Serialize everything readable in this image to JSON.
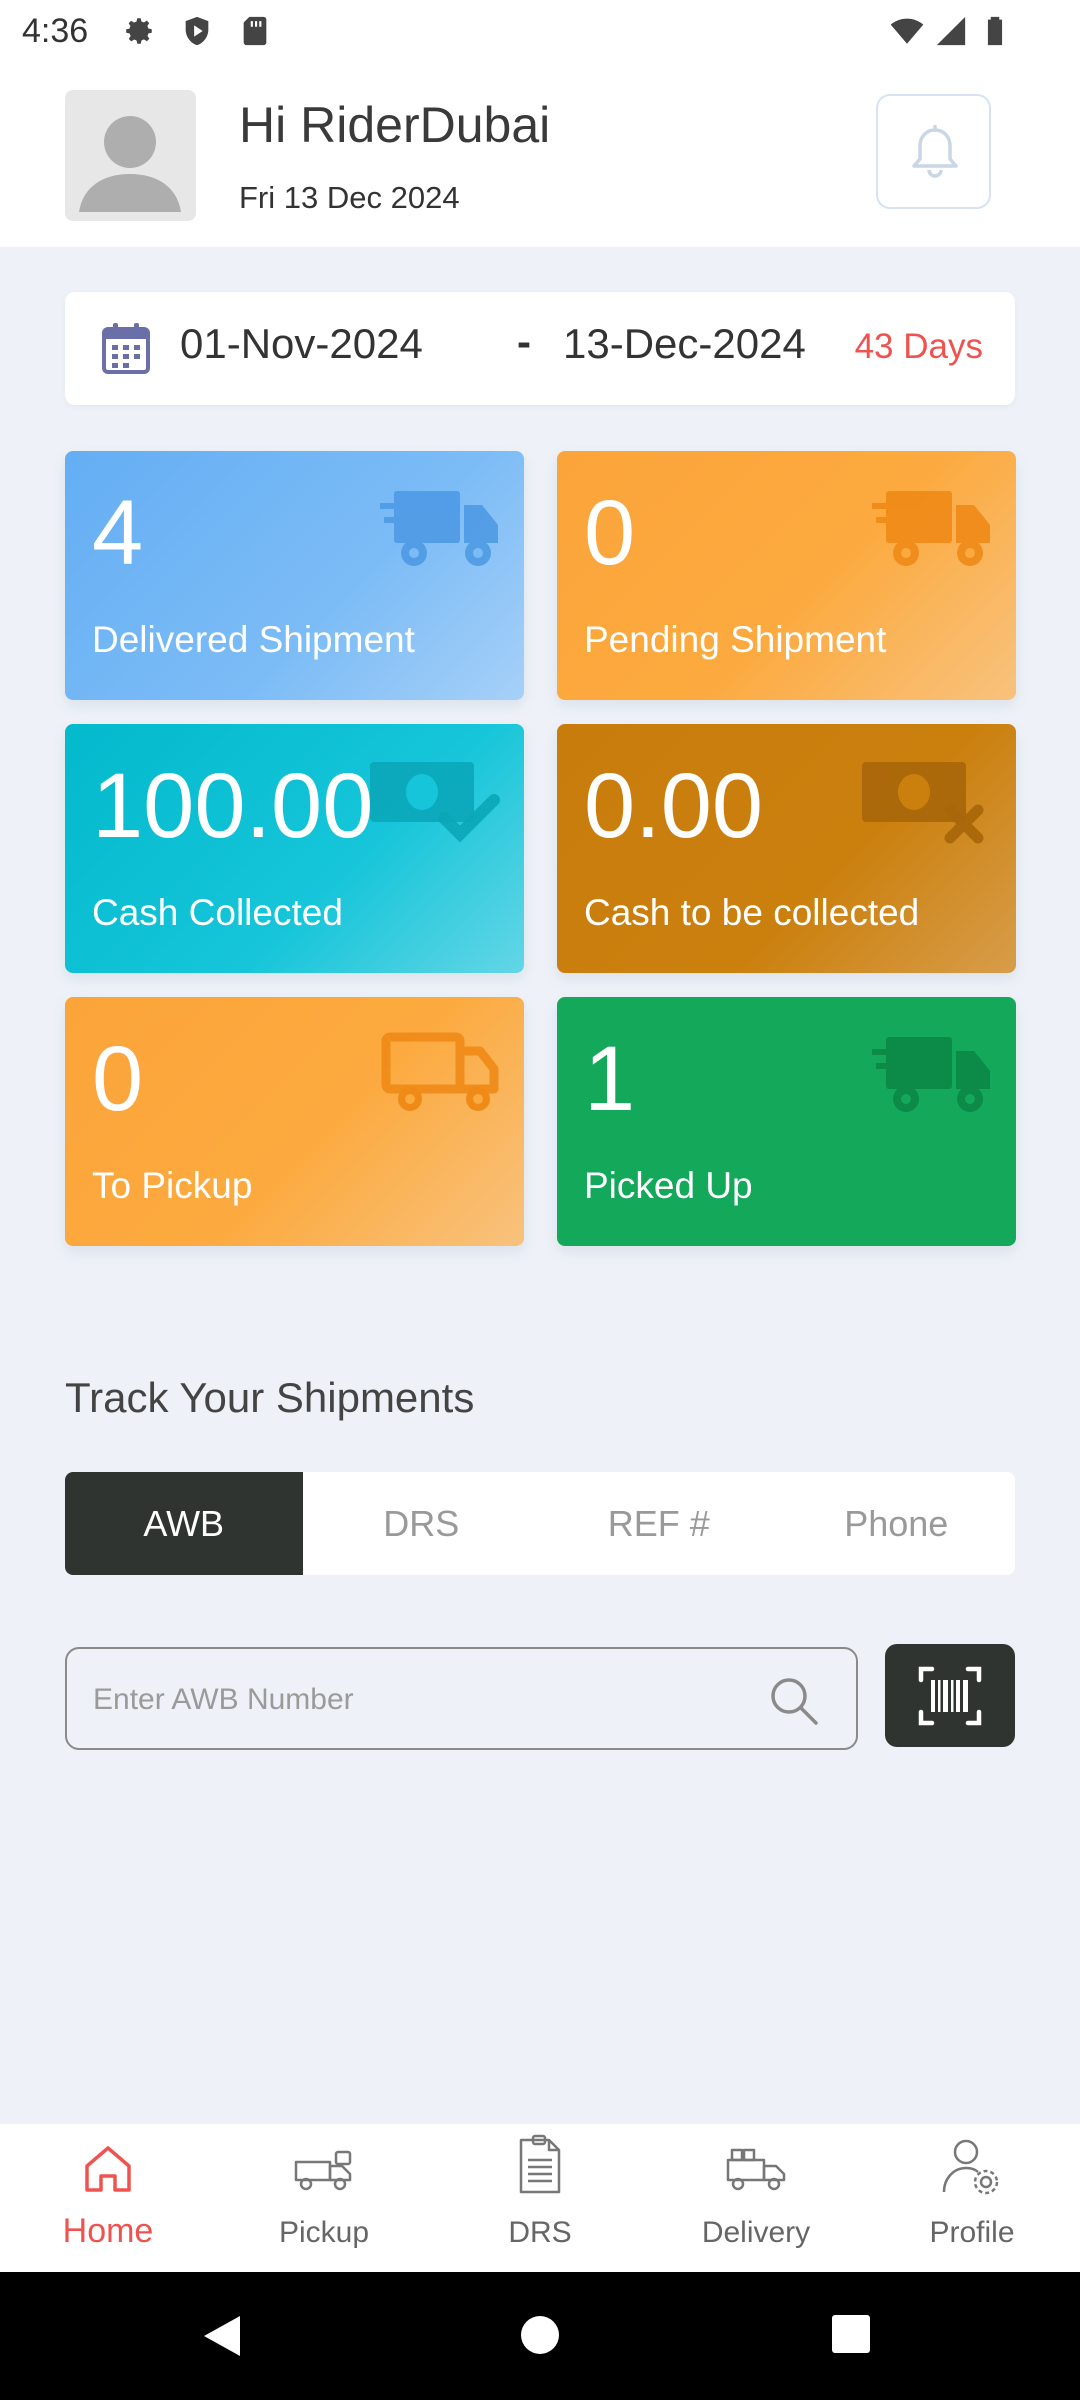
{
  "status_bar": {
    "time": "4:36",
    "left_icons": [
      "gear-icon",
      "shield-icon",
      "sd-card-icon"
    ],
    "right_icons": [
      "wifi-icon",
      "signal-icon",
      "battery-icon"
    ]
  },
  "header": {
    "greeting": "Hi RiderDubai",
    "date": "Fri 13 Dec 2024",
    "avatar_icon": "user-placeholder-icon",
    "bell_icon": "bell-icon"
  },
  "date_range": {
    "start": "01-Nov-2024",
    "separator": "-",
    "end": "13-Dec-2024",
    "days": "43 Days",
    "days_color": "#ef5350"
  },
  "tiles": [
    {
      "value": "4",
      "label": "Delivered Shipment",
      "icon": "truck-icon",
      "color": "#64aef4"
    },
    {
      "value": "0",
      "label": "Pending Shipment",
      "icon": "truck-icon",
      "color": "#fba43a"
    },
    {
      "value": "100.00",
      "label": "Cash Collected",
      "icon": "cash-check-icon",
      "color": "#03b9cc"
    },
    {
      "value": "0.00",
      "label": "Cash to be collected",
      "icon": "cash-cross-icon",
      "color": "#c87c0c"
    },
    {
      "value": "0",
      "label": "To Pickup",
      "icon": "truck-outline-icon",
      "color": "#fba43a"
    },
    {
      "value": "1",
      "label": "Picked Up",
      "icon": "truck-icon",
      "color": "#13a85a"
    }
  ],
  "track": {
    "title": "Track Your Shipments",
    "tabs": [
      "AWB",
      "DRS",
      "REF #",
      "Phone"
    ],
    "active_tab": "AWB",
    "search_placeholder": "Enter AWB Number",
    "search_value": "",
    "scan_icon": "barcode-scan-icon"
  },
  "bottom_nav": [
    {
      "label": "Home",
      "icon": "home-icon",
      "active": true
    },
    {
      "label": "Pickup",
      "icon": "pickup-truck-icon",
      "active": false
    },
    {
      "label": "DRS",
      "icon": "document-icon",
      "active": false
    },
    {
      "label": "Delivery",
      "icon": "delivery-truck-icon",
      "active": false
    },
    {
      "label": "Profile",
      "icon": "profile-settings-icon",
      "active": false
    }
  ],
  "accent_color": "#ef5350",
  "dark_color": "#2f3431"
}
